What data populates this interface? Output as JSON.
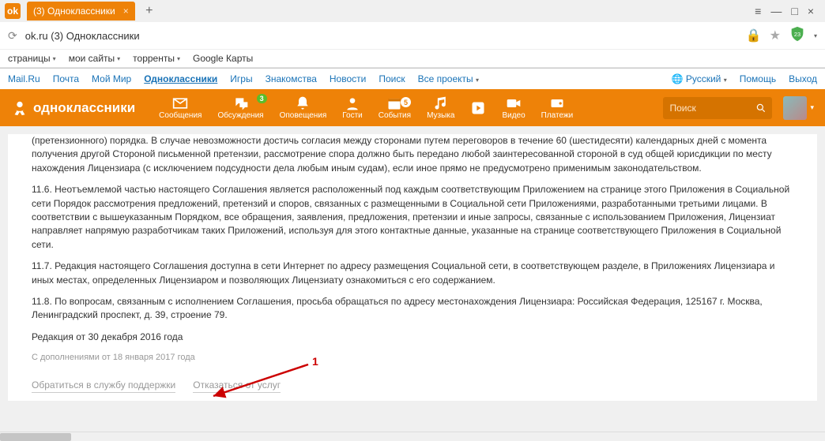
{
  "browser": {
    "tab_title": "(3) Одноклассники",
    "new_tab": "+",
    "window_controls": {
      "menu": "≡",
      "min": "—",
      "max": "□",
      "close": "×"
    },
    "address": {
      "reload_icon": "reload-icon",
      "text": "ok.ru (3) Одноклассники",
      "lock": "🔒",
      "star": "★",
      "shield_badge": "23"
    }
  },
  "bookmarks": [
    {
      "label": "страницы",
      "dd": "▾"
    },
    {
      "label": "мои сайты",
      "dd": "▾"
    },
    {
      "label": "торренты",
      "dd": "▾"
    },
    {
      "label": "Google Карты",
      "dd": ""
    }
  ],
  "mailru": {
    "links": [
      "Mail.Ru",
      "Почта",
      "Мой Мир",
      "Одноклассники",
      "Игры",
      "Знакомства",
      "Новости",
      "Поиск",
      "Все проекты"
    ],
    "active_index": 3,
    "projects_dd": "▾",
    "lang": "Русский",
    "lang_dd": "▾",
    "help": "Помощь",
    "exit": "Выход"
  },
  "ok": {
    "brand": "одноклассники",
    "nav": [
      {
        "key": "messages",
        "label": "Сообщения"
      },
      {
        "key": "discussions",
        "label": "Обсуждения",
        "badge_green": "3"
      },
      {
        "key": "notifications",
        "label": "Оповещения"
      },
      {
        "key": "guests",
        "label": "Гости"
      },
      {
        "key": "events",
        "label": "События",
        "badge_dot": "5"
      },
      {
        "key": "music",
        "label": "Музыка"
      },
      {
        "key": "spacer1",
        "label": ""
      },
      {
        "key": "video",
        "label": "Видео"
      },
      {
        "key": "payments",
        "label": "Платежи"
      }
    ],
    "search_placeholder": "Поиск"
  },
  "content": {
    "p115": "(претензионного) порядка. В случае невозможности достичь согласия между сторонами путем переговоров в течение 60 (шестидесяти) календарных дней с момента получения другой Стороной письменной претензии, рассмотрение спора должно быть передано любой заинтересованной стороной в суд общей юрисдикции по месту нахождения Лицензиара (с исключением подсудности дела любым иным судам), если иное прямо не предусмотрено применимым законодательством.",
    "p116": "11.6. Неотъемлемой частью настоящего Соглашения является расположенный под каждым соответствующим Приложением на странице этого Приложения в Социальной сети Порядок рассмотрения предложений, претензий и споров, связанных с размещенными в Социальной сети Приложениями, разработанными третьими лицами. В соответствии с вышеуказанным Порядком, все обращения, заявления, предложения, претензии и иные запросы, связанные с использованием Приложения, Лицензиат направляет напрямую разработчикам таких Приложений, используя для этого контактные данные, указанные на странице соответствующего Приложения в Социальной сети.",
    "p117": "11.7. Редакция настоящего Соглашения доступна в сети Интернет по адресу размещения Социальной сети, в соответствующем разделе, в Приложениях Лицензиара и иных местах, определенных Лицензиаром и позволяющих Лицензиату ознакомиться с его содержанием.",
    "p118": "11.8. По вопросам, связанным с исполнением Соглашения, просьба обращаться по адресу местонахождения Лицензиара: Российская Федерация, 125167 г. Москва, Ленинградский проспект, д. 39, строение 79.",
    "edition": "Редакция от 30 декабря 2016 года",
    "supplement": "С дополнениями от 18 января 2017 года",
    "link_support": "Обратиться в службу поддержки",
    "link_optout": "Отказаться от услуг"
  },
  "annotation": {
    "label": "1"
  }
}
